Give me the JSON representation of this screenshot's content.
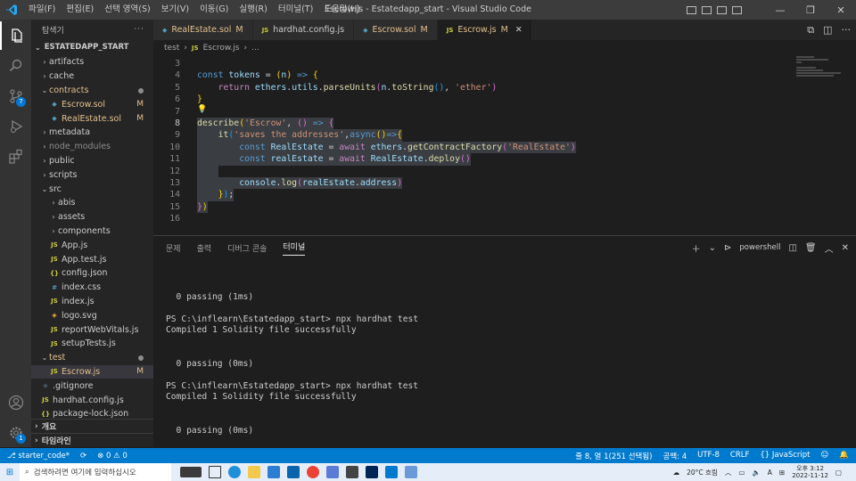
{
  "window": {
    "title": "Escrow.js - Estatedapp_start - Visual Studio Code",
    "menu": [
      "파일(F)",
      "편집(E)",
      "선택 영역(S)",
      "보기(V)",
      "이동(G)",
      "실행(R)",
      "터미널(T)",
      "도움말(H)"
    ]
  },
  "sidebar": {
    "header": "탐색기",
    "root": "ESTATEDAPP_START",
    "items": [
      {
        "label": "artifacts",
        "type": "folder",
        "depth": 1,
        "dim": false
      },
      {
        "label": "cache",
        "type": "folder",
        "depth": 1,
        "dim": false
      },
      {
        "label": "contracts",
        "type": "folder-open",
        "depth": 1,
        "dim": false,
        "color": "#e2c08d",
        "dot": true
      },
      {
        "label": "Escrow.sol",
        "type": "sol",
        "depth": 2,
        "color": "#e2c08d",
        "status": "M"
      },
      {
        "label": "RealEstate.sol",
        "type": "sol",
        "depth": 2,
        "color": "#e2c08d",
        "status": "M"
      },
      {
        "label": "metadata",
        "type": "folder",
        "depth": 1,
        "dim": false
      },
      {
        "label": "node_modules",
        "type": "folder",
        "depth": 1,
        "dim": true
      },
      {
        "label": "public",
        "type": "folder",
        "depth": 1,
        "dim": false
      },
      {
        "label": "scripts",
        "type": "folder",
        "depth": 1,
        "dim": false
      },
      {
        "label": "src",
        "type": "folder-open",
        "depth": 1,
        "dim": false
      },
      {
        "label": "abis",
        "type": "folder",
        "depth": 2,
        "dim": false
      },
      {
        "label": "assets",
        "type": "folder",
        "depth": 2,
        "dim": false
      },
      {
        "label": "components",
        "type": "folder",
        "depth": 2,
        "dim": false
      },
      {
        "label": "App.js",
        "type": "js",
        "depth": 2
      },
      {
        "label": "App.test.js",
        "type": "js",
        "depth": 2
      },
      {
        "label": "config.json",
        "type": "json",
        "depth": 2
      },
      {
        "label": "index.css",
        "type": "css",
        "depth": 2
      },
      {
        "label": "index.js",
        "type": "js",
        "depth": 2
      },
      {
        "label": "logo.svg",
        "type": "svg",
        "depth": 2
      },
      {
        "label": "reportWebVitals.js",
        "type": "js",
        "depth": 2
      },
      {
        "label": "setupTests.js",
        "type": "js",
        "depth": 2
      },
      {
        "label": "test",
        "type": "folder-open",
        "depth": 1,
        "color": "#e2c08d",
        "dot": true
      },
      {
        "label": "Escrow.js",
        "type": "js",
        "depth": 2,
        "color": "#e2c08d",
        "status": "M",
        "selected": true
      },
      {
        "label": ".gitignore",
        "type": "git",
        "depth": 1
      },
      {
        "label": "hardhat.config.js",
        "type": "js",
        "depth": 1
      },
      {
        "label": "package-lock.json",
        "type": "json",
        "depth": 1
      }
    ],
    "outline": "개요",
    "timeline": "타임라인"
  },
  "tabs": [
    {
      "label": "RealEstate.sol",
      "icon": "sol",
      "status": "M",
      "active": false
    },
    {
      "label": "hardhat.config.js",
      "icon": "js",
      "status": "",
      "active": false
    },
    {
      "label": "Escrow.sol",
      "icon": "sol",
      "status": "M",
      "active": false
    },
    {
      "label": "Escrow.js",
      "icon": "js",
      "status": "M",
      "active": true
    }
  ],
  "breadcrumb": [
    "test",
    "Escrow.js",
    "..."
  ],
  "code": {
    "line_numbers": [
      "3",
      "4",
      "5",
      "6",
      "7",
      "8",
      "9",
      "10",
      "11",
      "12",
      "13",
      "14",
      "15",
      "16"
    ]
  },
  "panel": {
    "tabs": [
      "문제",
      "출력",
      "디버그 콘솔",
      "터미널"
    ],
    "active_tab": "터미널",
    "shell": "powershell",
    "lines": [
      "",
      "  0 passing (1ms)",
      "",
      "PS C:\\inflearn\\Estatedapp_start> npx hardhat test",
      "Compiled 1 Solidity file successfully",
      "",
      "",
      "  0 passing (0ms)",
      "",
      "PS C:\\inflearn\\Estatedapp_start> npx hardhat test",
      "Compiled 1 Solidity file successfully",
      "",
      "",
      "  0 passing (0ms)",
      "",
      "PS C:\\inflearn\\Estatedapp_start> "
    ]
  },
  "status": {
    "branch": "starter_code*",
    "sync": "⟳",
    "problems": "⊗ 0 ⚠ 0",
    "position": "줄 8, 열 1(251 선택됨)",
    "spaces": "공백: 4",
    "encoding": "UTF-8",
    "eol": "CRLF",
    "language": "{} JavaScript"
  },
  "taskbar": {
    "search_placeholder": "검색하려면 여기에 입력하십시오",
    "weather": "20°C 흐림",
    "ime": "A",
    "time": "오후 3:12",
    "date": "2022-11-12"
  }
}
